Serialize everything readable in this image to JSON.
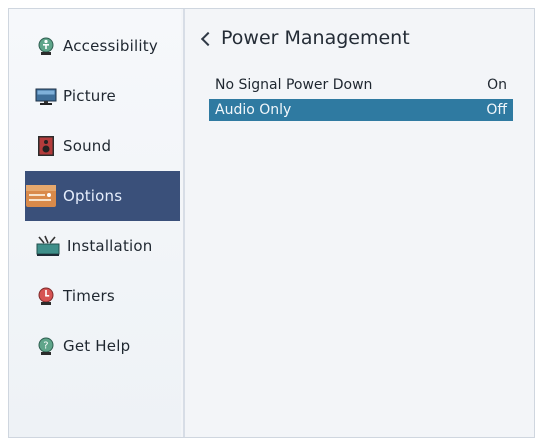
{
  "sidebar": {
    "items": [
      {
        "label": "Accessibility",
        "icon": "accessibility-icon",
        "active": false
      },
      {
        "label": "Picture",
        "icon": "picture-icon",
        "active": false
      },
      {
        "label": "Sound",
        "icon": "sound-icon",
        "active": false
      },
      {
        "label": "Options",
        "icon": "options-icon",
        "active": true
      },
      {
        "label": "Installation",
        "icon": "installation-icon",
        "active": false
      },
      {
        "label": "Timers",
        "icon": "timers-icon",
        "active": false
      },
      {
        "label": "Get Help",
        "icon": "get-help-icon",
        "active": false
      }
    ]
  },
  "page": {
    "title": "Power Management"
  },
  "settings": [
    {
      "label": "No Signal Power Down",
      "value": "On",
      "selected": false
    },
    {
      "label": "Audio Only",
      "value": "Off",
      "selected": true
    }
  ],
  "colors": {
    "active_menu_bg": "#3a507a",
    "selected_row_bg": "#2f7aa1",
    "panel_bg": "#f3f5f8"
  }
}
